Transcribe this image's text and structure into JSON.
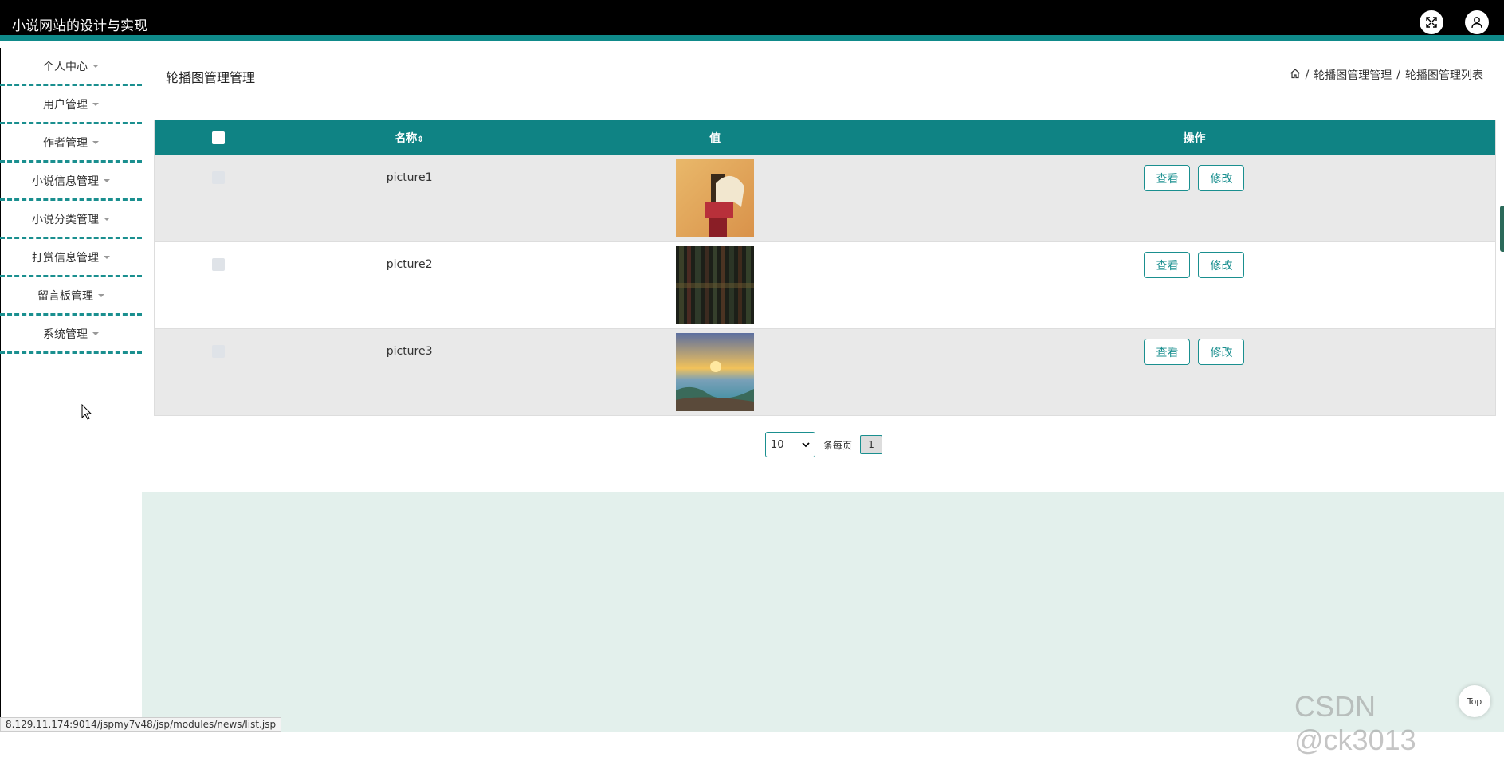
{
  "app": {
    "title": "小说网站的设计与实现"
  },
  "header_icons": [
    "fullscreen-icon",
    "user-icon"
  ],
  "sidebar": {
    "items": [
      {
        "label": "个人中心"
      },
      {
        "label": "用户管理"
      },
      {
        "label": "作者管理"
      },
      {
        "label": "小说信息管理"
      },
      {
        "label": "小说分类管理"
      },
      {
        "label": "打赏信息管理"
      },
      {
        "label": "留言板管理"
      },
      {
        "label": "系统管理"
      }
    ]
  },
  "page": {
    "title": "轮播图管理管理",
    "breadcrumb": [
      "轮播图管理管理",
      "轮播图管理列表"
    ],
    "breadcrumb_sep": "/"
  },
  "table": {
    "columns": {
      "name": "名称",
      "sort_icon": "⇕",
      "value": "值",
      "actions": "操作"
    },
    "rows": [
      {
        "name": "picture1",
        "value_image": "red-book-image"
      },
      {
        "name": "picture2",
        "value_image": "dark-bookshelf-image"
      },
      {
        "name": "picture3",
        "value_image": "sunset-coast-image"
      }
    ],
    "view_label": "查看",
    "edit_label": "修改"
  },
  "pagination": {
    "page_size": "10",
    "per_page_label": "条每页",
    "current_page": "1"
  },
  "status_url": "8.129.11.174:9014/jspmy7v48/jsp/modules/news/list.jsp",
  "watermark": "CSDN @ck3013",
  "top_button": "Top",
  "colors": {
    "header_bg": "#000000",
    "accent": "#0f8384",
    "row_gray": "#e9e9e9",
    "bottom_bg": "#e3f0ec"
  }
}
